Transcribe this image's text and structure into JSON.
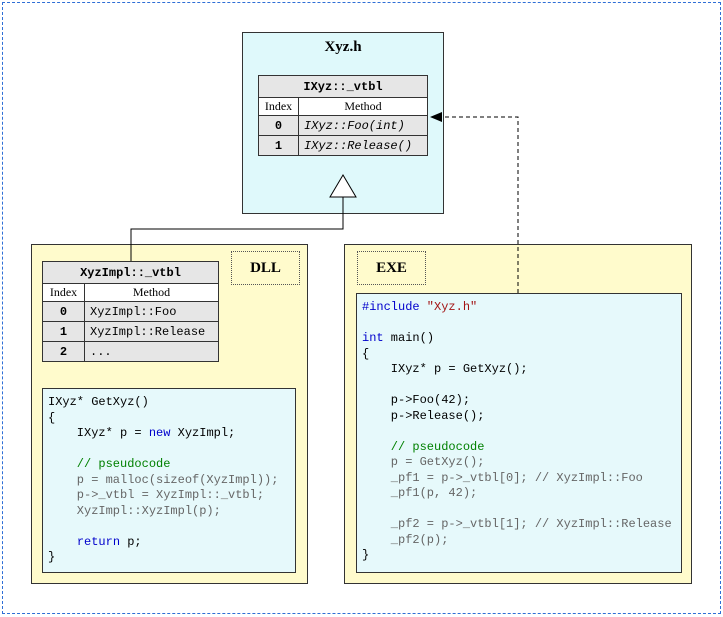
{
  "header": {
    "title": "Xyz.h",
    "vtable": {
      "caption": "IXyz::_vtbl",
      "col_index": "Index",
      "col_method": "Method",
      "rows": [
        {
          "index": "0",
          "method": "IXyz::Foo(int)"
        },
        {
          "index": "1",
          "method": "IXyz::Release()"
        }
      ]
    }
  },
  "dll": {
    "label": "DLL",
    "vtable": {
      "caption": "XyzImpl::_vtbl",
      "col_index": "Index",
      "col_method": "Method",
      "rows": [
        {
          "index": "0",
          "method": "XyzImpl::Foo"
        },
        {
          "index": "1",
          "method": "XyzImpl::Release"
        },
        {
          "index": "2",
          "method": "..."
        }
      ]
    },
    "code": {
      "l1": "IXyz* GetXyz()",
      "l2": "{",
      "l3a": "    IXyz* p = ",
      "l3kw": "new",
      "l3b": " XyzImpl;",
      "l5": "    // pseudocode",
      "l6": "    p = malloc(sizeof(XyzImpl));",
      "l7": "    p->_vtbl = XyzImpl::_vtbl;",
      "l8": "    XyzImpl::XyzImpl(p);",
      "l10kw": "return",
      "l10b": " p;",
      "l11": "}"
    }
  },
  "exe": {
    "label": "EXE",
    "code": {
      "l1kw": "#include",
      "l1str": " \"Xyz.h\"",
      "l3kw": "int",
      "l3b": " main()",
      "l4": "{",
      "l5": "    IXyz* p = GetXyz();",
      "l7": "    p->Foo(42);",
      "l8": "    p->Release();",
      "l10": "    // pseudocode",
      "l11": "    p = GetXyz();",
      "l12": "    _pf1 = p->_vtbl[0]; // XyzImpl::Foo",
      "l13": "    _pf1(p, 42);",
      "l15": "    _pf2 = p->_vtbl[1]; // XyzImpl::Release",
      "l16": "    _pf2(p);",
      "l17": "}"
    }
  }
}
